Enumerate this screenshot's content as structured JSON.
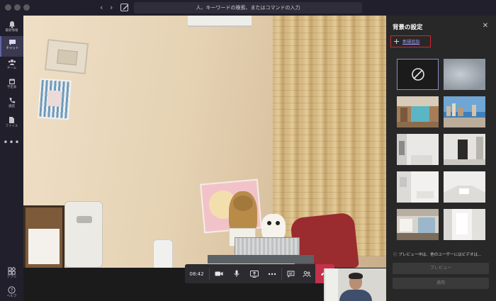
{
  "titlebar": {
    "search_placeholder": "人、キーワードの検索、またはコマンドの入力"
  },
  "rail": {
    "items": [
      {
        "label": "最新情報",
        "icon": "bell-icon"
      },
      {
        "label": "チャット",
        "icon": "chat-icon",
        "active": true
      },
      {
        "label": "チーム",
        "icon": "teams-icon"
      },
      {
        "label": "予定表",
        "icon": "calendar-icon"
      },
      {
        "label": "通話",
        "icon": "phone-icon"
      },
      {
        "label": "ファイル",
        "icon": "file-icon"
      }
    ],
    "more": "•••",
    "apps_label": "アプリ",
    "help_label": "ヘルプ"
  },
  "call": {
    "timer": "08:42",
    "controls": [
      "video-icon",
      "microphone-icon",
      "share-screen-icon",
      "more-icon",
      "chat-icon",
      "participants-icon",
      "hangup-icon"
    ],
    "hangup_color": "#c4314b"
  },
  "panel": {
    "title": "背景の設定",
    "add_new_label": "新規追加",
    "notice": "ⓘ プレビュー中は、他のユーザーにはビデオは...",
    "preview_button": "プレビュー",
    "apply_button": "適用",
    "backgrounds": [
      "none",
      "blur",
      "office-lobby",
      "city-skyline",
      "white-room",
      "dark-doorway",
      "white-interior",
      "white-studio",
      "office-workspace",
      "bright-hallway"
    ],
    "accent": "#6264a7",
    "highlight_border": "#d0262c"
  }
}
